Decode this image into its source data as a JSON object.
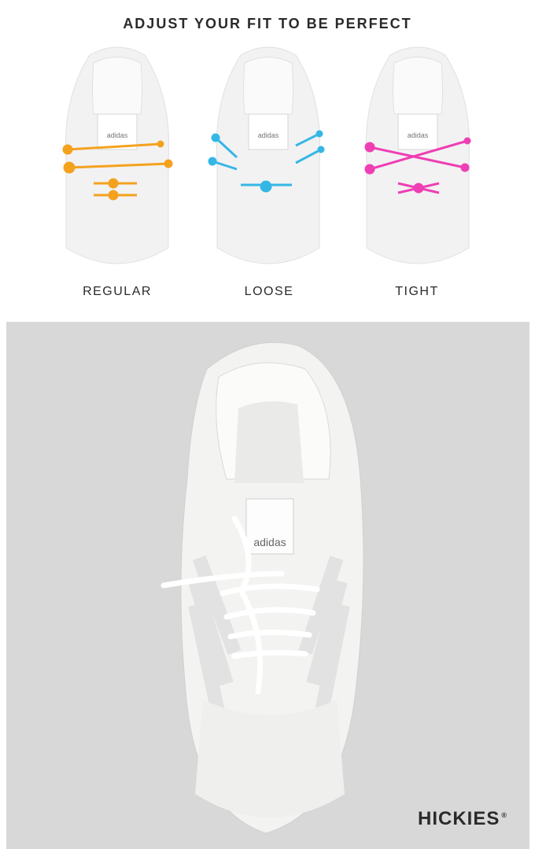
{
  "headline": "ADJUST YOUR FIT TO BE PERFECT",
  "fits": [
    {
      "label": "REGULAR",
      "color": "#f4a21e"
    },
    {
      "label": "LOOSE",
      "color": "#35b7e6"
    },
    {
      "label": "TIGHT",
      "color": "#ef3fb4"
    }
  ],
  "shoe_brand_text": "adidas",
  "photo": {
    "background": "#d8d8d9"
  },
  "brand": {
    "name": "HICKIES",
    "mark": "®"
  }
}
